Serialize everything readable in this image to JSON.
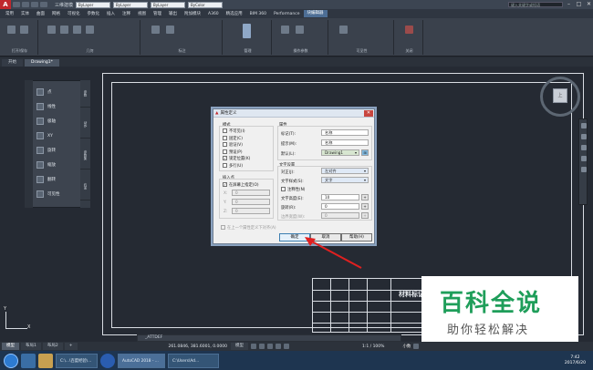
{
  "window": {
    "title": "三维建模",
    "search_placeholder": "键入关键字或短语",
    "prop_color": "ByLayer",
    "prop_linetype": "ByLayer",
    "prop_lineweight": "ByLayer",
    "prop_plotstyle": "ByColor"
  },
  "menu": {
    "items": [
      "常用",
      "实体",
      "曲面",
      "网格",
      "可视化",
      "参数化",
      "插入",
      "注释",
      "视图",
      "管理",
      "输出",
      "附加模块",
      "A360",
      "精选应用",
      "BIM 360",
      "Performance",
      "块编辑器"
    ],
    "active_index": 16
  },
  "ribbon": {
    "groups": [
      "打开/保存",
      "几何",
      "标注",
      "管理",
      "操作参数",
      "可见性",
      "关闭"
    ]
  },
  "tabs": {
    "start": "开始",
    "drawing": "Drawing1*"
  },
  "palette": {
    "items": [
      "点",
      "线性",
      "极轴",
      "XY",
      "旋转",
      "缩放",
      "翻转",
      "可见性"
    ],
    "tabs": [
      "参数",
      "动作",
      "参数集",
      "约束"
    ]
  },
  "viewcube": {
    "face": "上"
  },
  "ucs": {
    "x": "X",
    "y": "Y"
  },
  "dialog": {
    "title": "属性定义",
    "mode_header": "模式",
    "modes": [
      {
        "label": "不可见(I)",
        "checked": false
      },
      {
        "label": "固定(C)",
        "checked": false
      },
      {
        "label": "验证(V)",
        "checked": false
      },
      {
        "label": "预设(P)",
        "checked": false
      },
      {
        "label": "锁定位置(K)",
        "checked": true
      },
      {
        "label": "多行(U)",
        "checked": false
      }
    ],
    "attr_header": "属性",
    "tag_label": "标记(T):",
    "tag_value": "名称",
    "prompt_label": "提示(M):",
    "prompt_value": "名称",
    "default_label": "默认(L):",
    "default_value": "Drawing1",
    "insert_header": "插入点",
    "insert_onscreen": "在屏幕上指定(O)",
    "x_label": "X:",
    "x_value": "0",
    "y_label": "Y:",
    "y_value": "0",
    "z_label": "Z:",
    "z_value": "0",
    "text_header": "文字设置",
    "justify_label": "对正(J):",
    "justify_value": "左对齐",
    "style_label": "文字样式(S):",
    "style_value": "文字",
    "annotative_label": "注释性(N)",
    "height_label": "文字高度(E):",
    "height_value": "10",
    "rotation_label": "旋转(R):",
    "rotation_value": "0",
    "boundary_label": "边界宽度(W):",
    "boundary_value": "0",
    "align_below": "在上一个属性定义下对齐(A)",
    "ok": "确定",
    "cancel": "取消",
    "help": "帮助(H)"
  },
  "titleblock": {
    "title": "材料标记"
  },
  "watermark": {
    "line1": "百科全说",
    "line2": "助你轻松解决"
  },
  "cmdline": {
    "text": "_ATTDEF"
  },
  "status": {
    "layout_tabs": [
      "模型",
      "布局1",
      "布局2"
    ],
    "coords": "261.0846, 381.6001, 0.0000",
    "model": "模型",
    "scale": "1:1 / 100%",
    "units": "小数"
  },
  "taskbar": {
    "items": [
      "C:\\...\\百度经验\\...",
      "AutoCAD 2018 - ...",
      "C:\\Users\\Ad..."
    ],
    "time": "7:42",
    "date": "2017/6/20"
  },
  "colors": {
    "accent": "#4d6e95",
    "autocad_red": "#c0282d",
    "arrow": "#e02020",
    "watermark_green": "#1f9e5a"
  }
}
